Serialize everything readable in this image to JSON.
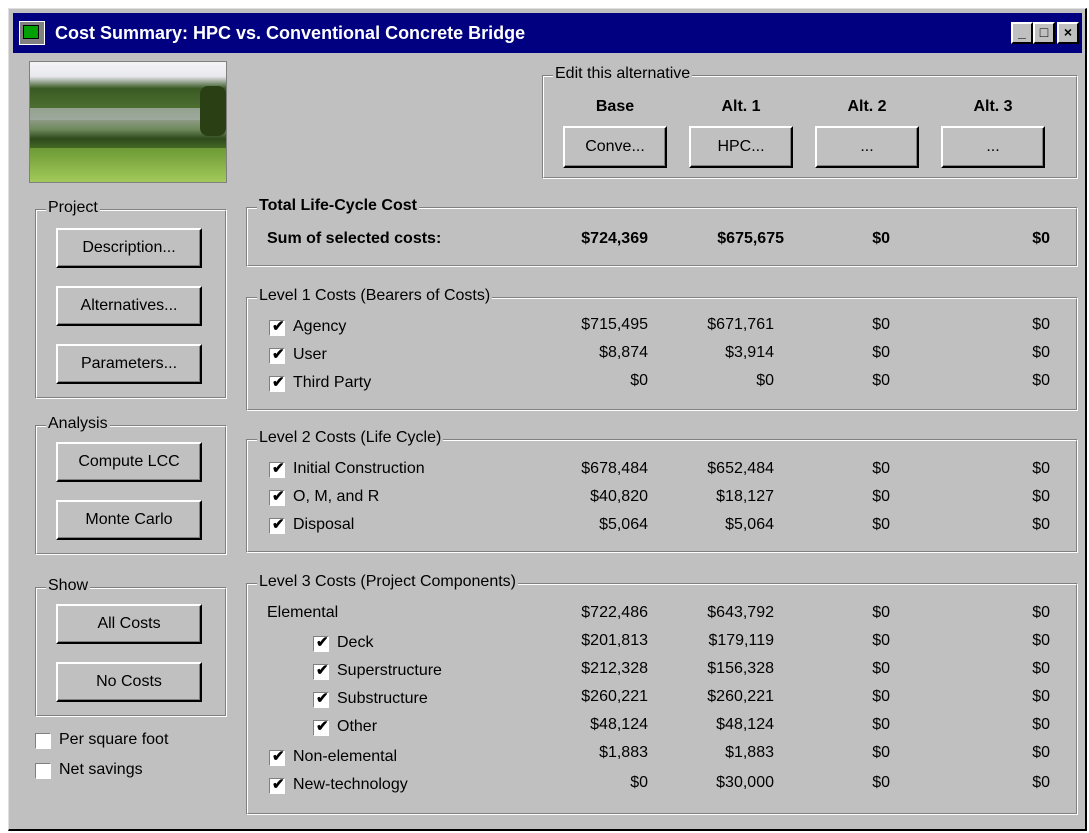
{
  "window": {
    "title": "Cost Summary: HPC vs. Conventional Concrete Bridge",
    "min": "_",
    "max": "□",
    "close": "×"
  },
  "edit_alt": {
    "legend": "Edit this alternative",
    "cols": [
      {
        "header": "Base",
        "button": "Conve..."
      },
      {
        "header": "Alt. 1",
        "button": "HPC..."
      },
      {
        "header": "Alt. 2",
        "button": "..."
      },
      {
        "header": "Alt. 3",
        "button": "..."
      }
    ]
  },
  "project": {
    "legend": "Project",
    "description": "Description...",
    "alternatives": "Alternatives...",
    "parameters": "Parameters..."
  },
  "analysis": {
    "legend": "Analysis",
    "compute": "Compute LCC",
    "monte": "Monte Carlo"
  },
  "show": {
    "legend": "Show",
    "all": "All Costs",
    "none": "No Costs"
  },
  "options": {
    "per_sqft": "Per square foot",
    "net_savings": "Net savings"
  },
  "total": {
    "legend": "Total Life-Cycle Cost",
    "label": "Sum of selected costs:",
    "values": [
      "$724,369",
      "$675,675",
      "$0",
      "$0"
    ]
  },
  "level1": {
    "legend": "Level 1 Costs (Bearers of Costs)",
    "rows": [
      {
        "label": "Agency",
        "values": [
          "$715,495",
          "$671,761",
          "$0",
          "$0"
        ]
      },
      {
        "label": "User",
        "values": [
          "$8,874",
          "$3,914",
          "$0",
          "$0"
        ]
      },
      {
        "label": "Third Party",
        "values": [
          "$0",
          "$0",
          "$0",
          "$0"
        ]
      }
    ]
  },
  "level2": {
    "legend": "Level 2 Costs (Life Cycle)",
    "rows": [
      {
        "label": "Initial Construction",
        "values": [
          "$678,484",
          "$652,484",
          "$0",
          "$0"
        ]
      },
      {
        "label": "O, M, and R",
        "values": [
          "$40,820",
          "$18,127",
          "$0",
          "$0"
        ]
      },
      {
        "label": "Disposal",
        "values": [
          "$5,064",
          "$5,064",
          "$0",
          "$0"
        ]
      }
    ]
  },
  "level3": {
    "legend": "Level 3 Costs (Project Components)",
    "elemental": {
      "label": "Elemental",
      "values": [
        "$722,486",
        "$643,792",
        "$0",
        "$0"
      ]
    },
    "sub_rows": [
      {
        "label": "Deck",
        "values": [
          "$201,813",
          "$179,119",
          "$0",
          "$0"
        ]
      },
      {
        "label": "Superstructure",
        "values": [
          "$212,328",
          "$156,328",
          "$0",
          "$0"
        ]
      },
      {
        "label": "Substructure",
        "values": [
          "$260,221",
          "$260,221",
          "$0",
          "$0"
        ]
      },
      {
        "label": "Other",
        "values": [
          "$48,124",
          "$48,124",
          "$0",
          "$0"
        ]
      }
    ],
    "rows": [
      {
        "label": "Non-elemental",
        "values": [
          "$1,883",
          "$1,883",
          "$0",
          "$0"
        ]
      },
      {
        "label": "New-technology",
        "values": [
          "$0",
          "$30,000",
          "$0",
          "$0"
        ]
      }
    ]
  },
  "check_glyph": "✔"
}
